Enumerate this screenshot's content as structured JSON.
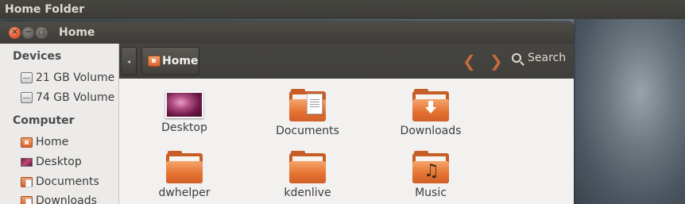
{
  "top_panel": {
    "title": "Home Folder"
  },
  "window": {
    "title": "Home",
    "buttons": {
      "close": "×",
      "minimize": "−",
      "maximize": "□"
    }
  },
  "sidebar": {
    "sections": [
      {
        "heading": "Devices",
        "items": [
          {
            "label": "21 GB Volume",
            "icon": "drive-icon"
          },
          {
            "label": "74 GB Volume",
            "icon": "drive-icon"
          }
        ]
      },
      {
        "heading": "Computer",
        "items": [
          {
            "label": "Home",
            "icon": "home-icon"
          },
          {
            "label": "Desktop",
            "icon": "desktop-icon"
          },
          {
            "label": "Documents",
            "icon": "documents-icon"
          },
          {
            "label": "Downloads",
            "icon": "downloads-icon"
          }
        ]
      }
    ]
  },
  "toolbar": {
    "back_glyph": "◂",
    "breadcrumb": "Home",
    "nav_back": "❮",
    "nav_forward": "❯",
    "search_label": "Search"
  },
  "files": [
    {
      "name": "Desktop",
      "icon": "desktop-folder-icon"
    },
    {
      "name": "Documents",
      "icon": "documents-folder-icon"
    },
    {
      "name": "Downloads",
      "icon": "downloads-folder-icon"
    },
    {
      "name": "dwhelper",
      "icon": "folder-icon"
    },
    {
      "name": "kdenlive",
      "icon": "folder-icon"
    },
    {
      "name": "Music",
      "icon": "music-folder-icon"
    }
  ],
  "colors": {
    "accent": "#e4712f",
    "panel": "#3c3b37",
    "window_bg": "#f2f1f0"
  }
}
